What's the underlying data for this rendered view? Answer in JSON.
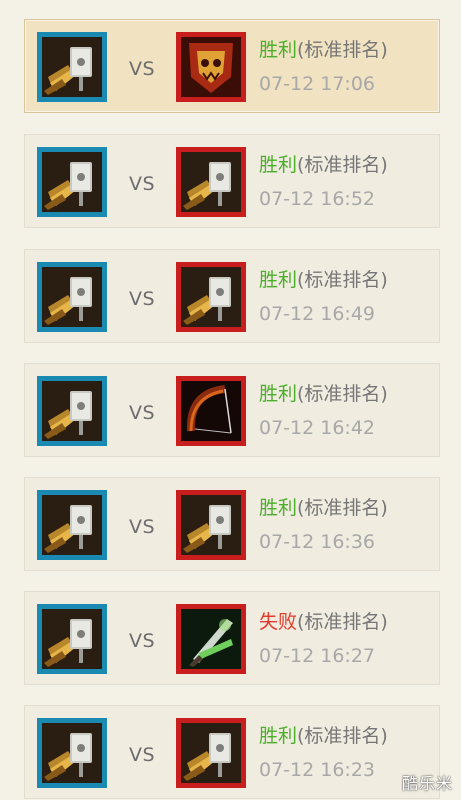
{
  "matches": [
    {
      "vs": "VS",
      "result": "胜利",
      "mode": "(标准排名)",
      "time": "07-12 17:06",
      "win": true,
      "active": true,
      "player_icon": "warrior-hammer-icon",
      "opponent_icon": "orc-skull-banner-icon"
    },
    {
      "vs": "VS",
      "result": "胜利",
      "mode": "(标准排名)",
      "time": "07-12 16:52",
      "win": true,
      "active": false,
      "player_icon": "warrior-hammer-icon",
      "opponent_icon": "warrior-hammer-icon"
    },
    {
      "vs": "VS",
      "result": "胜利",
      "mode": "(标准排名)",
      "time": "07-12 16:49",
      "win": true,
      "active": false,
      "player_icon": "warrior-hammer-icon",
      "opponent_icon": "warrior-hammer-icon"
    },
    {
      "vs": "VS",
      "result": "胜利",
      "mode": "(标准排名)",
      "time": "07-12 16:42",
      "win": true,
      "active": false,
      "player_icon": "warrior-hammer-icon",
      "opponent_icon": "hunter-bow-icon"
    },
    {
      "vs": "VS",
      "result": "胜利",
      "mode": "(标准排名)",
      "time": "07-12 16:36",
      "win": true,
      "active": false,
      "player_icon": "warrior-hammer-icon",
      "opponent_icon": "warrior-hammer-icon"
    },
    {
      "vs": "VS",
      "result": "失败",
      "mode": "(标准排名)",
      "time": "07-12 16:27",
      "win": false,
      "active": false,
      "player_icon": "warrior-hammer-icon",
      "opponent_icon": "rogue-daggers-icon"
    },
    {
      "vs": "VS",
      "result": "胜利",
      "mode": "(标准排名)",
      "time": "07-12 16:23",
      "win": true,
      "active": false,
      "player_icon": "warrior-hammer-icon",
      "opponent_icon": "warrior-hammer-icon"
    }
  ],
  "watermark": "酷乐米",
  "colors": {
    "win": "#4caf2b",
    "lose": "#e23a2b",
    "player_frame": "#1b8ab3",
    "opponent_frame": "#c81e1e",
    "active_card": "#f1e2c2"
  }
}
